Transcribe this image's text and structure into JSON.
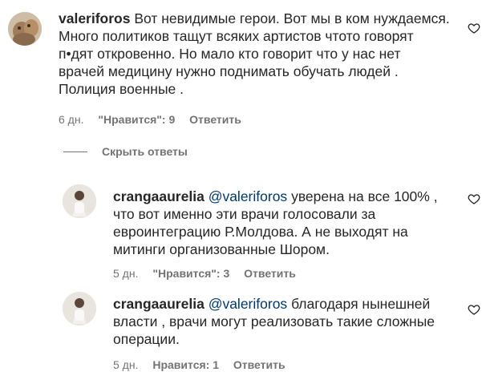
{
  "comments": [
    {
      "username": "valeriforos",
      "lines": [
        "Вот невидимые герои. Вот мы в ком нуждаемся.",
        "Много политиков тащут всяких артистов чтото говорят",
        "п•дят откровенно. Но мало кто говорит что у нас нет",
        "врачей медицину нужно поднимать обучать людей .",
        "Полиция военные ."
      ],
      "time": "6 дн.",
      "likes": "\"Нравится\": 9",
      "reply": "Ответить",
      "avatar_icon": "avatar-photo-icon"
    }
  ],
  "hide_replies": {
    "label": "Скрыть ответы"
  },
  "replies": [
    {
      "username": "crangaaurelia",
      "mention": "@valeriforos",
      "lines": [
        "уверена на все 100% ,",
        "что вот именно эти врачи голосовали за",
        "евроинтеграцию Р.Молдова. А не выходят на",
        "митинги организованные Шором."
      ],
      "time": "5 дн.",
      "likes": "\"Нравится\": 3",
      "reply": "Ответить"
    },
    {
      "username": "crangaaurelia",
      "mention": "@valeriforos",
      "lines": [
        "благодаря нынешней",
        "власти , врачи могут реализовать такие сложные",
        "операции."
      ],
      "time": "5 дн.",
      "likes": "Нравится: 1",
      "reply": "Ответить"
    }
  ],
  "colors": {
    "text": "#262626",
    "secondary": "#737373",
    "mention": "#00376b"
  },
  "icons": {
    "like": "heart-outline-icon"
  }
}
